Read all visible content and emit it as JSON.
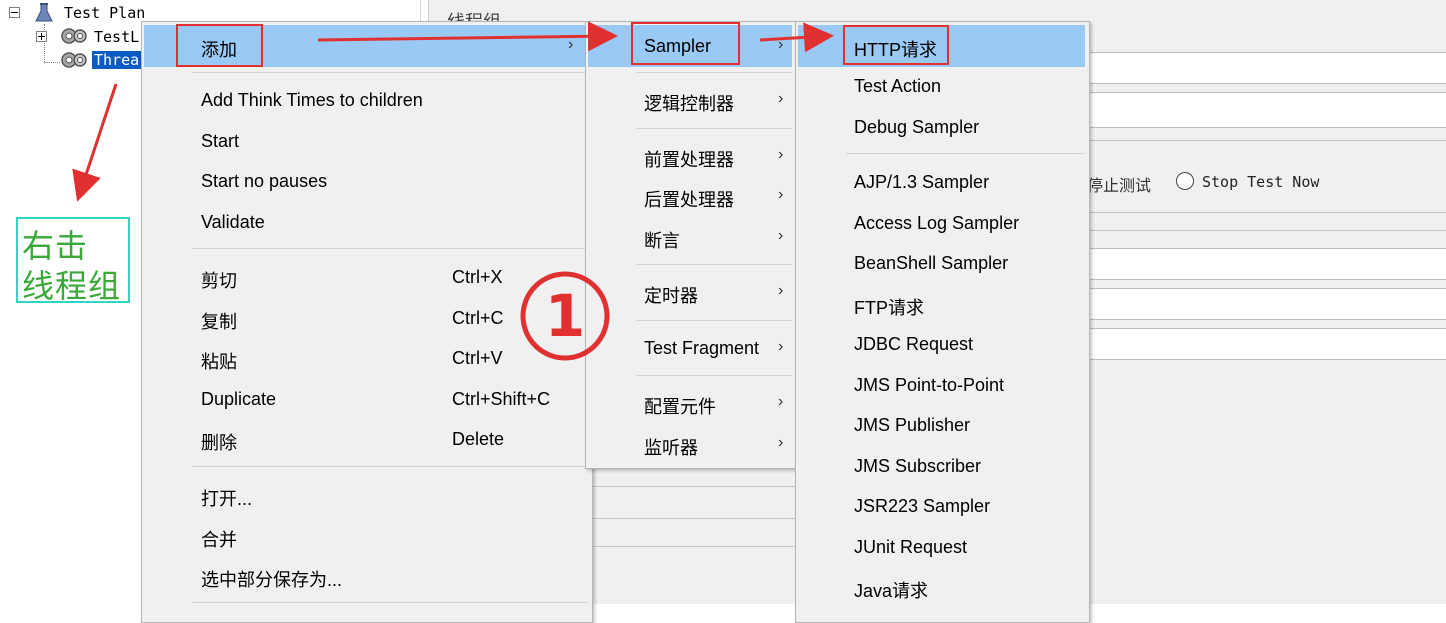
{
  "tree": {
    "items": [
      "Test Plan",
      "TestL",
      "Threa"
    ]
  },
  "background": {
    "partial_text": "线程组",
    "stop_test_label": "停止测试",
    "stop_test_now_label": "Stop Test Now"
  },
  "context_menu": {
    "add": "添加",
    "think_times": "Add Think Times to children",
    "start": "Start",
    "start_no_pauses": "Start no pauses",
    "validate": "Validate",
    "cut": "剪切",
    "cut_shortcut": "Ctrl+X",
    "copy": "复制",
    "copy_shortcut": "Ctrl+C",
    "paste": "粘贴",
    "paste_shortcut": "Ctrl+V",
    "duplicate": "Duplicate",
    "duplicate_shortcut": "Ctrl+Shift+C",
    "delete": "删除",
    "delete_shortcut": "Delete",
    "open": "打开...",
    "merge": "合并",
    "save_selection": "选中部分保存为..."
  },
  "add_submenu": {
    "sampler": "Sampler",
    "logic_controller": "逻辑控制器",
    "pre_processor": "前置处理器",
    "post_processor": "后置处理器",
    "assertion": "断言",
    "timer": "定时器",
    "test_fragment": "Test Fragment",
    "config_element": "配置元件",
    "listener": "监听器"
  },
  "sampler_submenu": {
    "items": [
      "HTTP请求",
      "Test Action",
      "Debug Sampler",
      "AJP/1.3 Sampler",
      "Access Log Sampler",
      "BeanShell Sampler",
      "FTP请求",
      "JDBC Request",
      "JMS Point-to-Point",
      "JMS Publisher",
      "JMS Subscriber",
      "JSR223 Sampler",
      "JUnit Request",
      "Java请求"
    ]
  },
  "annotation": {
    "line1": "右击",
    "line2": "线程组",
    "step_marker": "①"
  },
  "colors": {
    "highlight": "#99c9f4",
    "annotation_red": "#e03030",
    "annotation_green": "#3aa93a",
    "annotation_box": "#2cd6c8",
    "tree_selection": "#0a5bc4"
  }
}
